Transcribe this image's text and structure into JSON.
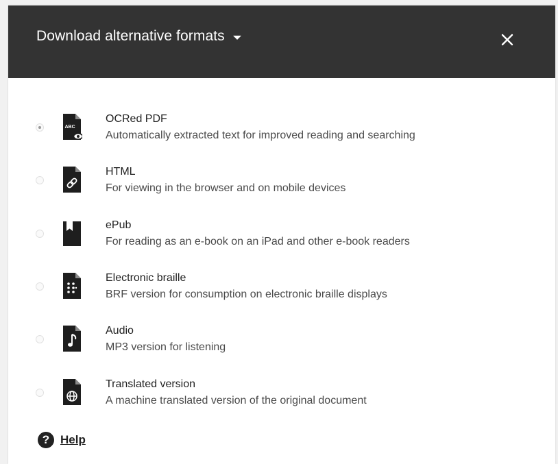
{
  "dialog": {
    "title": "Download alternative formats",
    "close_icon": "close-icon",
    "colors": {
      "header_bg": "#333333",
      "header_text": "#ffffff"
    }
  },
  "options": [
    {
      "title": "OCRed PDF",
      "description": "Automatically extracted text for improved reading and searching",
      "icon": "ocr-pdf-icon",
      "selected": true
    },
    {
      "title": "HTML",
      "description": "For viewing in the browser and on mobile devices",
      "icon": "html-link-icon",
      "selected": false
    },
    {
      "title": "ePub",
      "description": "For reading as an e-book on an iPad and other e-book readers",
      "icon": "epub-book-icon",
      "selected": false
    },
    {
      "title": "Electronic braille",
      "description": "BRF version for consumption on electronic braille displays",
      "icon": "braille-icon",
      "selected": false
    },
    {
      "title": "Audio",
      "description": "MP3 version for listening",
      "icon": "audio-note-icon",
      "selected": false
    },
    {
      "title": "Translated version",
      "description": "A machine translated version of the original document",
      "icon": "translate-globe-icon",
      "selected": false
    }
  ],
  "ocr_icon_text": "ABC",
  "help": {
    "label": "Help",
    "icon_glyph": "?"
  }
}
